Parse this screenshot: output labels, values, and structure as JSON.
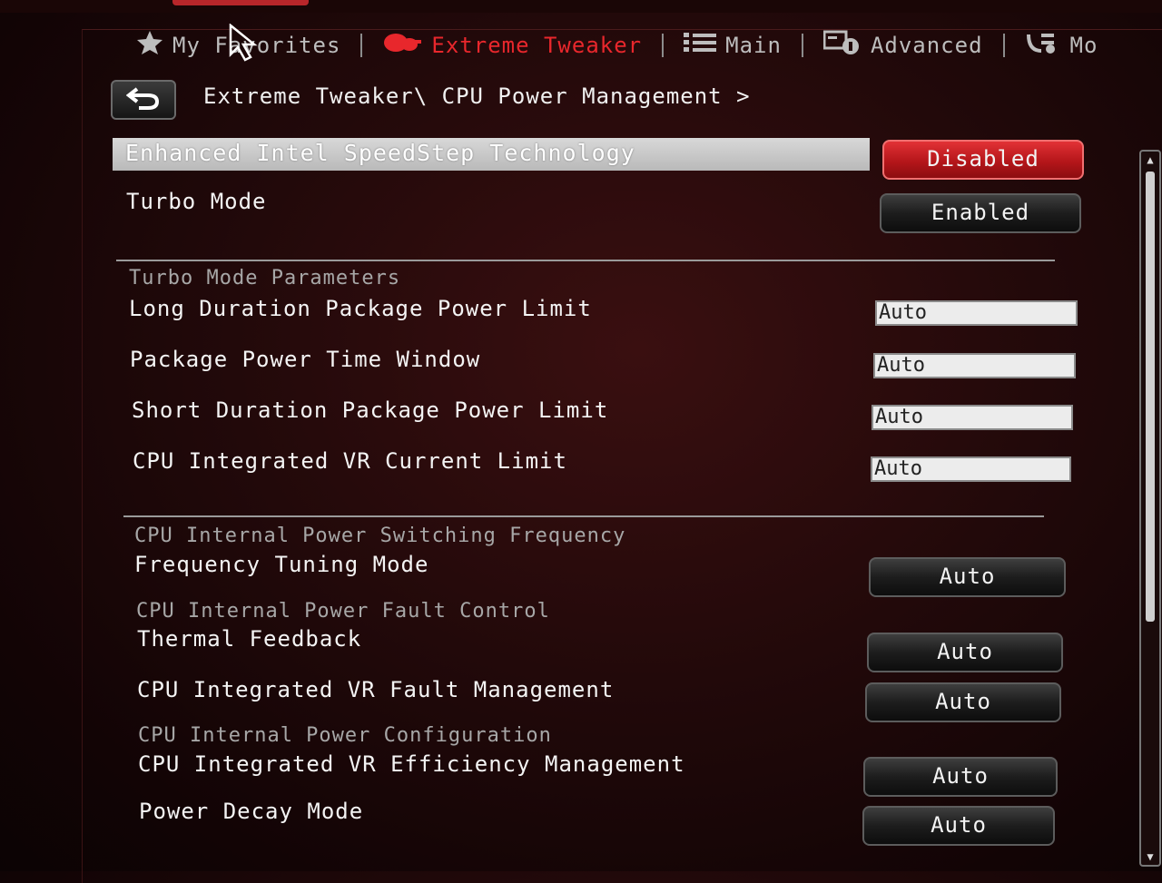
{
  "nav": {
    "items": [
      {
        "label": "My Favorites",
        "icon": "star-icon"
      },
      {
        "label": "Extreme Tweaker",
        "icon": "tweaker-icon",
        "active": true
      },
      {
        "label": "Main",
        "icon": "list-icon"
      },
      {
        "label": "Advanced",
        "icon": "advanced-icon"
      },
      {
        "label": "Mo",
        "icon": "monitor-icon"
      }
    ]
  },
  "breadcrumb": "Extreme Tweaker\\ CPU Power Management >",
  "settings": {
    "speedstep": {
      "label": "Enhanced Intel SpeedStep Technology",
      "value": "Disabled"
    },
    "turbo_mode": {
      "label": "Turbo Mode",
      "value": "Enabled"
    },
    "turbo_params_heading": "Turbo Mode Parameters",
    "long_duration": {
      "label": "Long Duration Package Power Limit",
      "value": "Auto"
    },
    "time_window": {
      "label": "Package Power Time Window",
      "value": "Auto"
    },
    "short_duration": {
      "label": "Short Duration Package Power Limit",
      "value": "Auto"
    },
    "vr_current": {
      "label": "CPU Integrated VR Current Limit",
      "value": "Auto"
    },
    "switching_heading": "CPU Internal Power Switching Frequency",
    "freq_tuning": {
      "label": "Frequency Tuning Mode",
      "value": "Auto"
    },
    "fault_heading": "CPU Internal Power Fault Control",
    "thermal_feedback": {
      "label": "Thermal Feedback",
      "value": "Auto"
    },
    "vr_fault": {
      "label": "CPU Integrated VR Fault Management",
      "value": "Auto"
    },
    "config_heading": "CPU Internal Power Configuration",
    "vr_efficiency": {
      "label": "CPU Integrated VR Efficiency Management",
      "value": "Auto"
    },
    "power_decay": {
      "label": "Power Decay Mode",
      "value": "Auto"
    }
  },
  "colors": {
    "accent": "#e8272c",
    "selected_row": "#c8c8c8",
    "background": "#22090a"
  }
}
